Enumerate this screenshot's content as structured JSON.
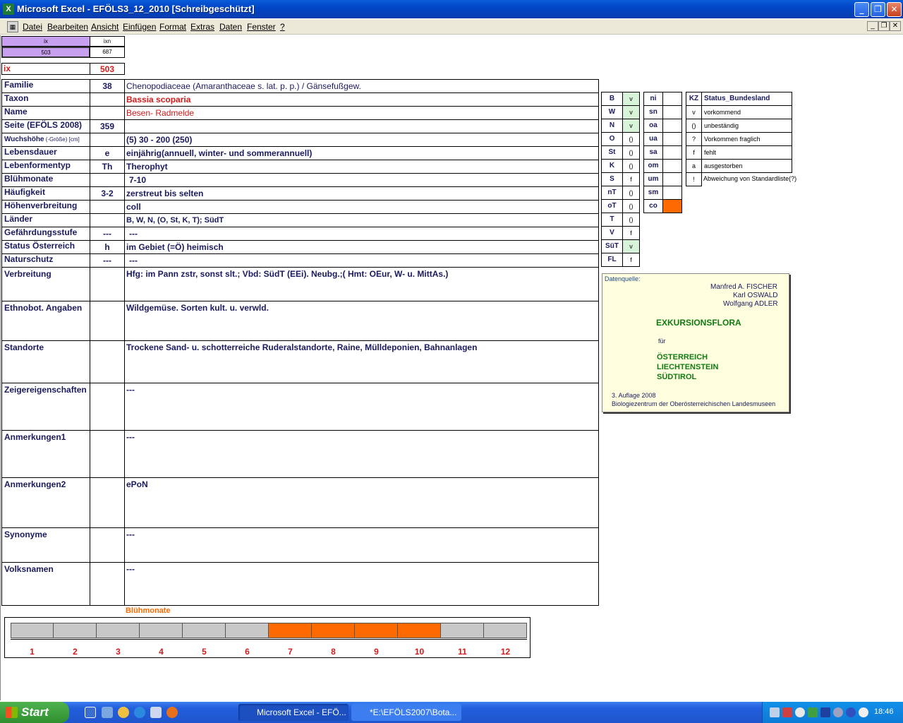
{
  "window": {
    "title": "Microsoft Excel - EFÖLS3_12_2010  [Schreibgeschützt]"
  },
  "menu": [
    "Datei",
    "Bearbeiten",
    "Ansicht",
    "Einfügen",
    "Format",
    "Extras",
    "Daten",
    "Fenster",
    "?"
  ],
  "index": {
    "ix_header": "ix",
    "ixn_header": "ixn",
    "ix_val": "503",
    "ixn_val": "687",
    "ix_label": "ix",
    "ix_big": "503"
  },
  "rows": [
    {
      "label": "Familie",
      "code": "38",
      "value": "Chenopodiaceae (Amaranthaceae s. lat. p. p.)  /  Gänsefußgew."
    },
    {
      "label": "Taxon",
      "code": "",
      "value": "Bassia scoparia"
    },
    {
      "label": "Name",
      "code": "",
      "value": "Besen- Radmelde"
    },
    {
      "label": "Seite (EFÖLS 2008)",
      "code": "359",
      "value": ""
    },
    {
      "label": "Wuchshöhe",
      "label_small": " (-Größe) [cm]",
      "code": "",
      "value": "(5) 30 - 200 (250)"
    },
    {
      "label": "Lebensdauer",
      "code": "e",
      "value": "einjährig(annuell, winter- und sommerannuell)"
    },
    {
      "label": "Lebenformentyp",
      "code": "Th",
      "value": "Therophyt"
    },
    {
      "label": "Blühmonate",
      "code": "",
      "value": "7-10"
    },
    {
      "label": "Häufigkeit",
      "code": "3-2",
      "value": "zerstreut bis selten"
    },
    {
      "label": "Höhenverbreitung",
      "code": "",
      "value": "coll"
    },
    {
      "label": "Länder",
      "code": "",
      "value": "B, W, N, (O, St, K, T); SüdT"
    },
    {
      "label": "Gefährdungsstufe",
      "code": "---",
      "value": "---"
    },
    {
      "label": "Status Österreich",
      "code": "h",
      "value": "im Gebiet (=Ö) heimisch"
    },
    {
      "label": "Naturschutz",
      "code": "---",
      "value": "---"
    }
  ],
  "bigrows": [
    {
      "label": "Verbreitung",
      "value": "Hfg: im Pann zstr, sonst slt.; Vbd: SüdT (EEi). Neubg.;( Hmt: OEur, W- u. MittAs.)"
    },
    {
      "label": "Ethnobot. Angaben",
      "value": "Wildgemüse. Sorten kult. u. verwld."
    },
    {
      "label": "Standorte",
      "value": "Trockene Sand- u. schotterreiche Ruderalstandorte, Raine, Mülldeponien, Bahnanlagen"
    },
    {
      "label": "Zeigereigenschaften",
      "value": "---"
    },
    {
      "label": "Anmerkungen1",
      "value": "---"
    },
    {
      "label": "Anmerkungen2",
      "value": "ePoN"
    },
    {
      "label": "Synonyme",
      "value": "---"
    },
    {
      "label": "Volksnamen",
      "value": "---"
    }
  ],
  "states": [
    {
      "kz": "B",
      "st": "v"
    },
    {
      "kz": "W",
      "st": "v"
    },
    {
      "kz": "N",
      "st": "v"
    },
    {
      "kz": "O",
      "st": "()"
    },
    {
      "kz": "St",
      "st": "()"
    },
    {
      "kz": "K",
      "st": "()"
    },
    {
      "kz": "S",
      "st": "f"
    },
    {
      "kz": "nT",
      "st": "()"
    },
    {
      "kz": "oT",
      "st": "()"
    },
    {
      "kz": "T",
      "st": "()"
    },
    {
      "kz": "V",
      "st": "f"
    },
    {
      "kz": "SüT",
      "st": "v"
    },
    {
      "kz": "FL",
      "st": "f"
    }
  ],
  "alt": [
    {
      "kz": "ni",
      "st": ""
    },
    {
      "kz": "sn",
      "st": ""
    },
    {
      "kz": "oa",
      "st": ""
    },
    {
      "kz": "ua",
      "st": ""
    },
    {
      "kz": "sa",
      "st": ""
    },
    {
      "kz": "om",
      "st": ""
    },
    {
      "kz": "um",
      "st": ""
    },
    {
      "kz": "sm",
      "st": ""
    },
    {
      "kz": "co",
      "st": ""
    }
  ],
  "legend": {
    "header_kz": "KZ",
    "header_status": "Status_Bundesland",
    "items": [
      {
        "k": "v",
        "t": "vorkommend"
      },
      {
        "k": "()",
        "t": "unbeständig"
      },
      {
        "k": "?",
        "t": "Vorkommen fraglich"
      },
      {
        "k": "f",
        "t": "fehlt"
      },
      {
        "k": "a",
        "t": "ausgestorben"
      },
      {
        "k": "!",
        "t": "Abweichung von Standardliste(?)"
      }
    ]
  },
  "source": {
    "label": "Datenquelle:",
    "authors": [
      "Manfred A. FISCHER",
      "Karl OSWALD",
      "Wolfgang ADLER"
    ],
    "title": "EXKURSIONSFLORA",
    "fuer": "für",
    "countries": [
      "ÖSTERREICH",
      "LIECHTENSTEIN",
      "SÜDTIROL"
    ],
    "edition": "3. Auflage 2008",
    "publisher": "Biologiezentrum der Oberösterreichischen Landesmuseen"
  },
  "bloom": {
    "title": "Blühmonate",
    "months": [
      "1",
      "2",
      "3",
      "4",
      "5",
      "6",
      "7",
      "8",
      "9",
      "10",
      "11",
      "12"
    ],
    "active": [
      7,
      8,
      9,
      10
    ],
    "color_active": "#ff6a00",
    "color_inactive": "#c8c8c8"
  },
  "taskbar": {
    "start": "Start",
    "tasks": [
      "Microsoft Excel - EFÖ...",
      "*E:\\EFÖLS2007\\Bota..."
    ],
    "clock": "18:46"
  }
}
